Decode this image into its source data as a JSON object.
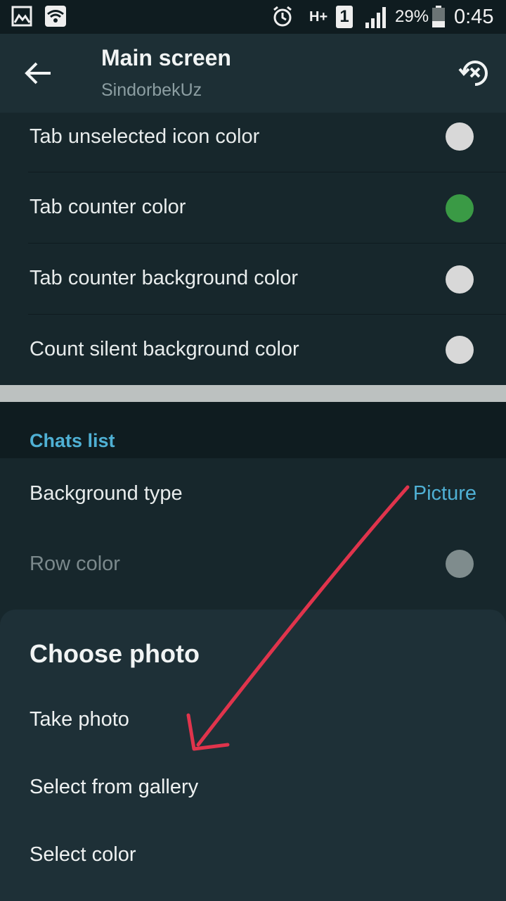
{
  "status_bar": {
    "battery_percent": "29%",
    "time": "0:45",
    "network_type": "H+",
    "sim_slot": "1",
    "icons": [
      "gallery-icon",
      "wifi-icon",
      "alarm-icon",
      "network-hplus-icon",
      "sim-icon",
      "signal-icon",
      "battery-icon"
    ]
  },
  "appbar": {
    "title": "Main screen",
    "subtitle": "SindorbekUz",
    "back_icon": "back-arrow-icon",
    "reset_icon": "reset-icon"
  },
  "main_screen_rows": [
    {
      "label": "Tab unselected icon color",
      "color": "#d8d8d8"
    },
    {
      "label": "Tab counter color",
      "color": "#3a9a45"
    },
    {
      "label": "Tab counter background color",
      "color": "#d8d8d8"
    },
    {
      "label": "Count silent background color",
      "color": "#d8d8d8"
    }
  ],
  "chats_list": {
    "header": "Chats list",
    "background_type": {
      "label": "Background type",
      "value": "Picture"
    },
    "row_color": {
      "label": "Row color",
      "color": "#7f8c8d"
    }
  },
  "sheet": {
    "title": "Choose photo",
    "items": [
      "Take photo",
      "Select from gallery",
      "Select color"
    ]
  },
  "colors": {
    "accent": "#4fb0d4",
    "annotation_arrow": "#e0344c"
  }
}
